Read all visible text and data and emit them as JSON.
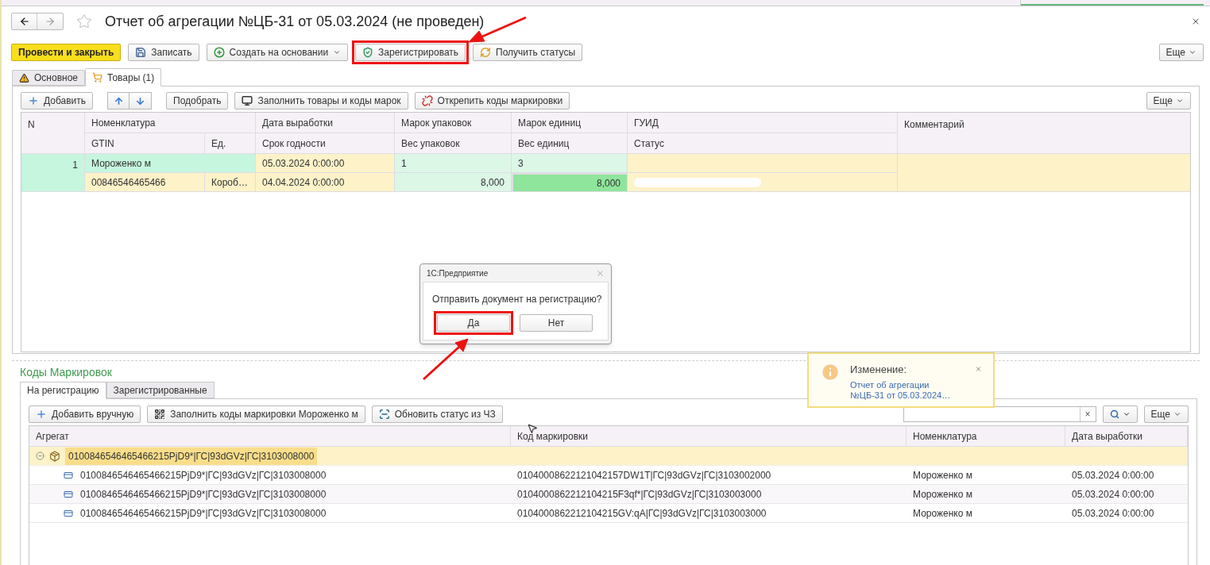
{
  "window": {
    "title": "Отчет об агрегации №ЦБ-31 от 05.03.2024 (не проведен)",
    "favorite": false
  },
  "toolbar": {
    "buttons": [
      {
        "label": "Провести и закрыть",
        "kind": "primary",
        "highlighted": false
      },
      {
        "label": "Записать",
        "kind": "save",
        "highlighted": false
      },
      {
        "label": "Создать на основании",
        "kind": "create",
        "highlighted": false
      },
      {
        "label": "Зарегистрировать",
        "kind": "register",
        "highlighted": true
      },
      {
        "label": "Получить статусы",
        "kind": "refresh",
        "highlighted": false
      }
    ],
    "more": "Еще"
  },
  "tabs": [
    {
      "label": "Основное",
      "kind": "warning",
      "selected": false
    },
    {
      "label": "Товары (1)",
      "kind": "cart",
      "selected": true
    }
  ],
  "goods": {
    "buttons": [
      {
        "label": "Добавить",
        "kind": "add"
      },
      {
        "label": "Подобрать",
        "kind": "plain"
      },
      {
        "label": "Заполнить товары и коды марок",
        "kind": "fill"
      },
      {
        "label": "Открепить коды маркировки",
        "kind": "detach"
      }
    ],
    "more": "Еще",
    "header_top": [
      "N",
      "Номенклатура",
      "Дата выработки",
      "Марок упаковок",
      "Марок единиц",
      "ГУИД",
      "Комментарий"
    ],
    "header_bottom": [
      "GTIN",
      "Ед.",
      "Срок годности",
      "Вес упаковок",
      "Вес единиц",
      "Статус"
    ],
    "rows": [
      {
        "n": "1",
        "name": "Мороженко м",
        "gtin": "00846546465466",
        "unit": "Короб…",
        "produced": "05.03.2024 0:00:00",
        "expires": "04.04.2024 0:00:00",
        "pack_marks": "1",
        "pack_weight": "8,000",
        "unit_marks": "3",
        "unit_weight": "8,000",
        "selected": true,
        "weight_focused": true
      }
    ]
  },
  "codes": {
    "title": "Коды Маркировок",
    "tabs": [
      {
        "label": "На регистрацию",
        "selected": true
      },
      {
        "label": "Зарегистрированные",
        "selected": false
      }
    ],
    "buttons": [
      {
        "label": "Добавить вручную",
        "kind": "add"
      },
      {
        "label": "Заполнить коды маркировки Мороженко м",
        "kind": "qr"
      },
      {
        "label": "Обновить статус из ЧЗ",
        "kind": "scan"
      }
    ],
    "search_clear": "×",
    "more": "Еще",
    "columns": [
      "Агрегат",
      "Код маркировки",
      "Номенклатура",
      "Дата выработки"
    ],
    "aggregate": {
      "code": "0100846546465466215PjD9*|ГС|93dGVz|ГС|3103008000",
      "expanded": true,
      "selected": true,
      "children": [
        {
          "aggregate": "0100846546465466215PjD9*|ГС|93dGVz|ГС|3103008000",
          "code": "01040008622121042157DW1T|ГС|93dGVz|ГС|3103002000",
          "name": "Мороженко м",
          "date": "05.03.2024 0:00:00"
        },
        {
          "aggregate": "0100846546465466215PjD9*|ГС|93dGVz|ГС|3103008000",
          "code": "0104000862212104215F3qf*|ГС|93dGVz|ГС|3103003000",
          "name": "Мороженко м",
          "date": "05.03.2024 0:00:00"
        },
        {
          "aggregate": "0100846546465466215PjD9*|ГС|93dGVz|ГС|3103008000",
          "code": "0104000862212104215GV:qA|ГС|93dGVz|ГС|3103003000",
          "name": "Мороженко м",
          "date": "05.03.2024 0:00:00"
        }
      ]
    }
  },
  "dialog": {
    "title": "1С:Предприятие",
    "message": "Отправить документ на регистрацию?",
    "buttons": [
      {
        "label": "Да",
        "highlighted": true
      },
      {
        "label": "Нет",
        "highlighted": false
      }
    ]
  },
  "notification": {
    "title": "Изменение:",
    "link": "Отчет об агрегации №ЦБ-31 от 05.03.2024…"
  }
}
